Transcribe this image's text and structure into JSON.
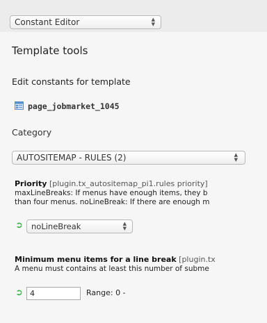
{
  "module_menu": {
    "selected": "Constant Editor"
  },
  "page": {
    "title": "Template tools",
    "section_heading": "Edit constants for template",
    "template_name": "page_jobmarket_1045",
    "category_label": "Category",
    "category_selected": "AUTOSITEMAP - RULES (2)"
  },
  "constants": [
    {
      "title": "Priority",
      "path": "[plugin.tx_autositemap_pi1.rules priority]",
      "description_line1": "maxLineBreaks: If menus have enough items, they b",
      "description_line2": "than four menus. noLineBreak: If there are enough m",
      "reset_icon": "reset-arrow-icon",
      "control_type": "select",
      "value": "noLineBreak"
    },
    {
      "title": "Minimum menu items for a line break",
      "path": "[plugin.tx",
      "description_line1": "A menu must contains at least this number of subme",
      "reset_icon": "reset-arrow-icon",
      "control_type": "input",
      "value": "4",
      "range_label": "Range: 0 -"
    }
  ],
  "colors": {
    "reset_green": "#3bb34a",
    "background": "#f6f6f6",
    "page_icon_blue": "#5a8fd0"
  }
}
